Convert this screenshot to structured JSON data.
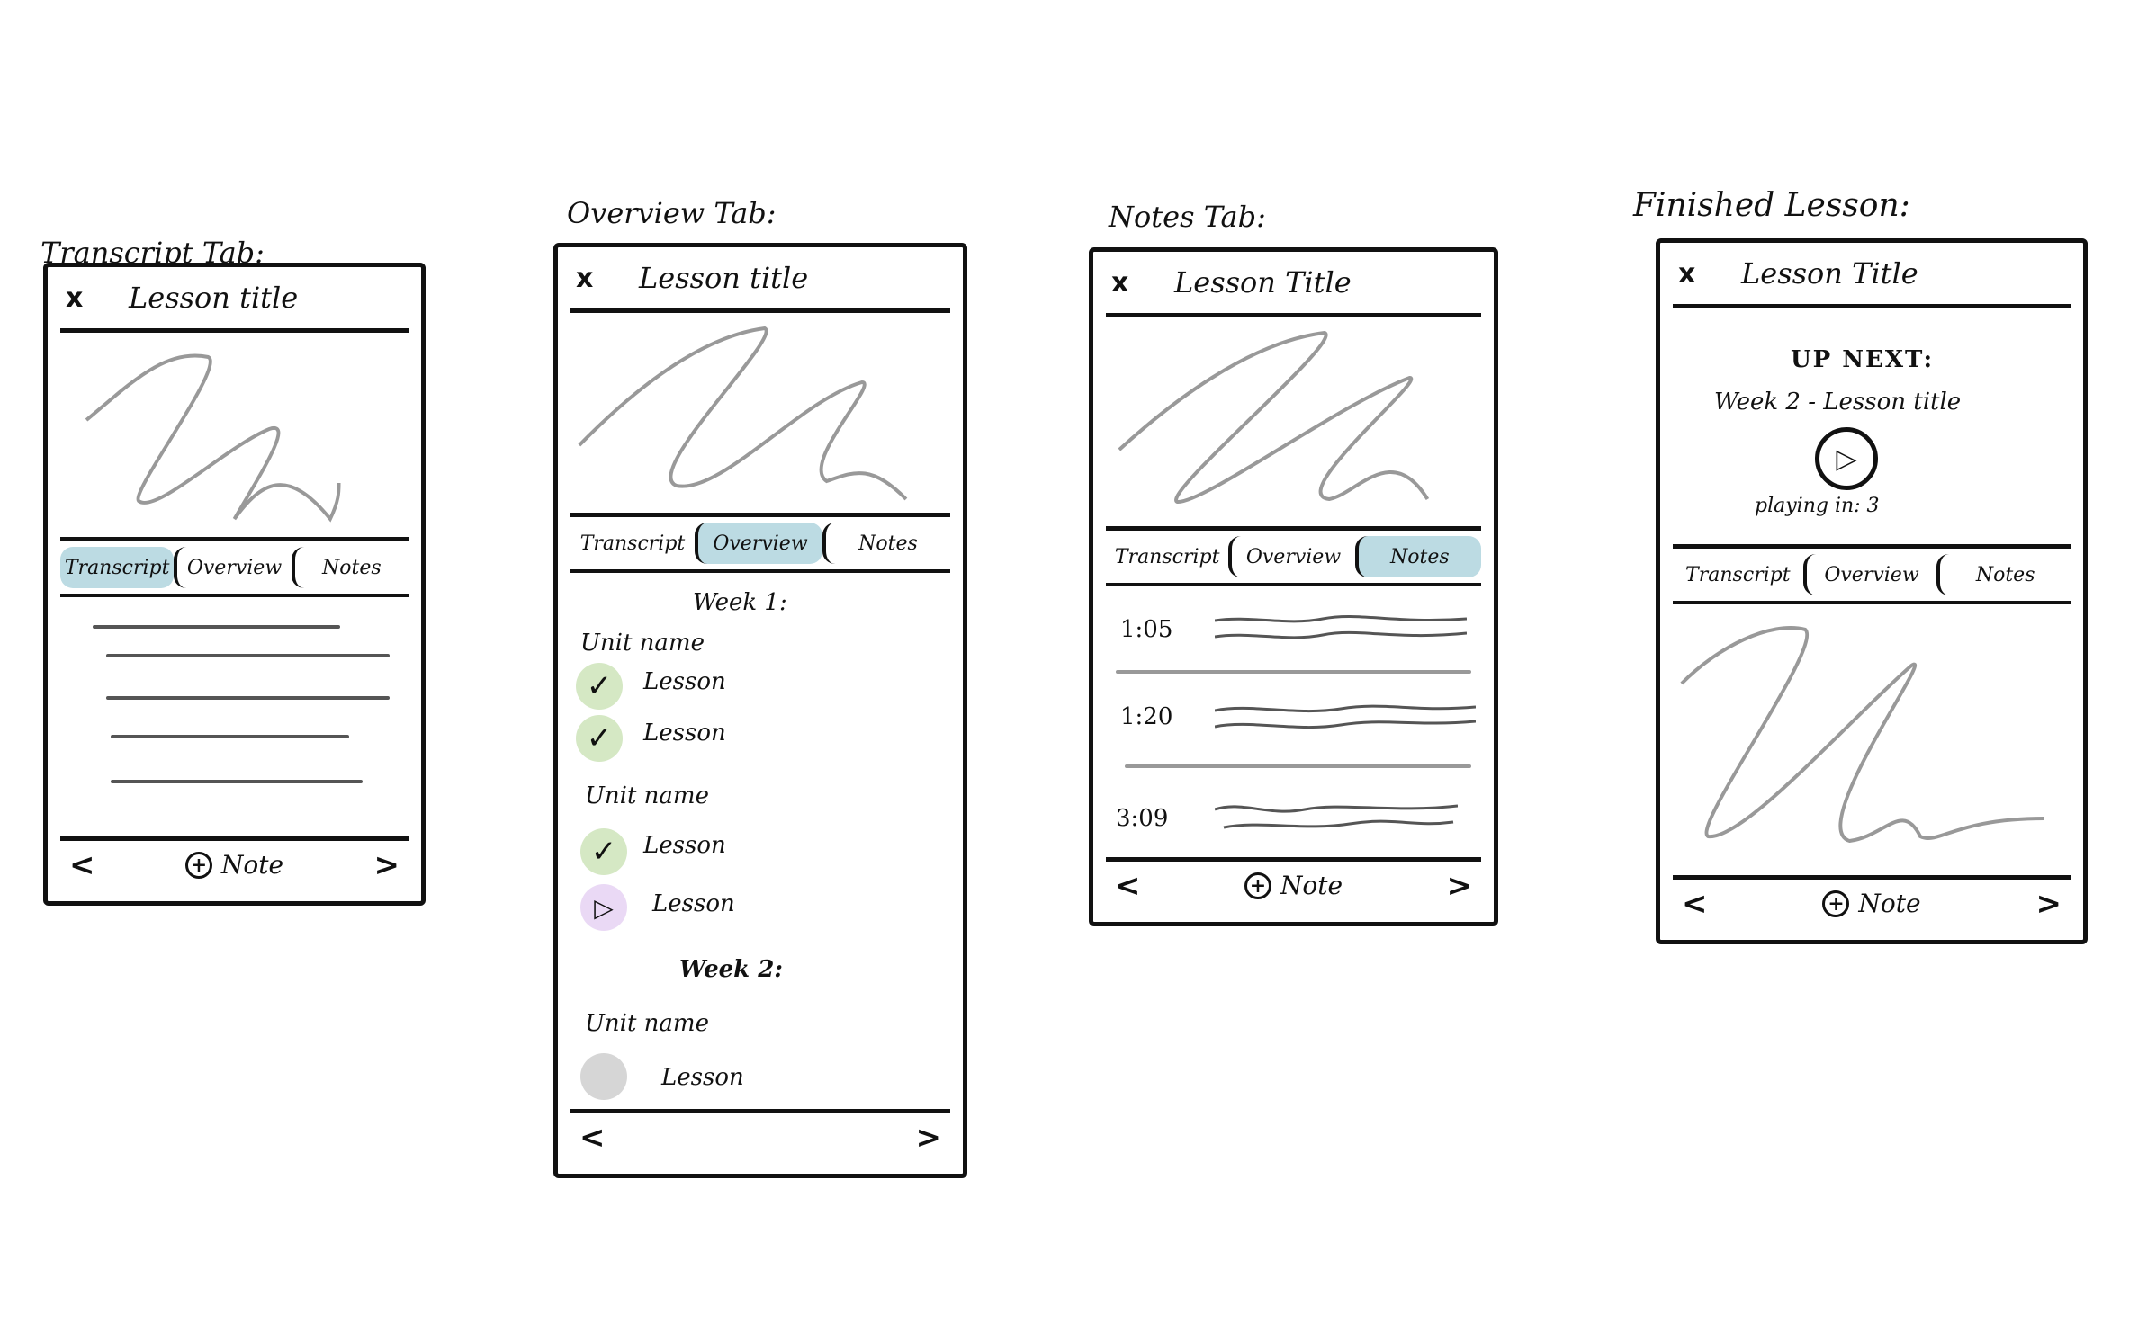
{
  "captions": {
    "transcript": "Transcript Tab:",
    "overview": "Overview Tab:",
    "notes": "Notes Tab:",
    "finished": "Finished Lesson:"
  },
  "common": {
    "close": "x",
    "prev": "<",
    "next": ">",
    "note_label": "Note",
    "plus": "+"
  },
  "transcript_frame": {
    "title": "Lesson title",
    "tabs": [
      "Transcript",
      "Overview",
      "Notes"
    ]
  },
  "overview_frame": {
    "title": "Lesson title",
    "tabs": [
      "Transcript",
      "Overview",
      "Notes"
    ],
    "week1": "Week 1:",
    "unit1": "Unit name",
    "unit2": "Unit name",
    "week2": "Week 2:",
    "unit3": "Unit name",
    "lesson": "Lesson",
    "check": "✓",
    "play": "▷",
    "colors": {
      "done": "#d5e8c4",
      "current": "#ead9f5",
      "locked": "#d6d6d6"
    }
  },
  "notes_frame": {
    "title": "Lesson Title",
    "tabs": [
      "Transcript",
      "Overview",
      "Notes"
    ],
    "times": [
      "1:05",
      "1:20",
      "3:09"
    ]
  },
  "finished_frame": {
    "title": "Lesson Title",
    "up_next": "UP NEXT:",
    "next_lesson": "Week 2 - Lesson title",
    "playing_in": "playing in: 3",
    "tabs": [
      "Transcript",
      "Overview",
      "Notes"
    ]
  },
  "colors": {
    "active_tab": "#bcdbe3",
    "scribble": "#999999"
  }
}
